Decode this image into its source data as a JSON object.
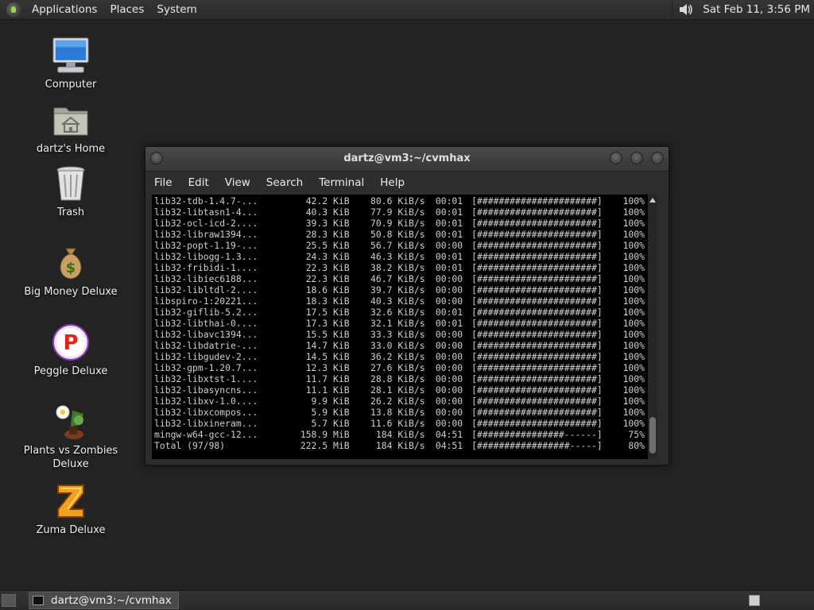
{
  "top_panel": {
    "applications": "Applications",
    "places": "Places",
    "system": "System",
    "clock": "Sat Feb 11,  3:56 PM"
  },
  "desktop_icons": [
    {
      "label": "Computer",
      "icon": "computer-icon"
    },
    {
      "label": "dartz's Home",
      "icon": "home-folder-icon"
    },
    {
      "label": "Trash",
      "icon": "trash-icon"
    },
    {
      "label": "Big Money Deluxe",
      "icon": "money-bag-icon"
    },
    {
      "label": "Peggle Deluxe",
      "icon": "peggle-icon"
    },
    {
      "label": "Plants vs Zombies Deluxe",
      "icon": "plants-vs-zombies-icon"
    },
    {
      "label": "Zuma Deluxe",
      "icon": "zuma-icon"
    }
  ],
  "terminal": {
    "title": "dartz@vm3:~/cvmhax",
    "menu": [
      "File",
      "Edit",
      "View",
      "Search",
      "Terminal",
      "Help"
    ],
    "lines": [
      {
        "name": "lib32-tdb-1.4.7-...",
        "size": "42.2 KiB",
        "rate": "80.6 KiB/s",
        "time": "00:01",
        "bar": "[######################]",
        "pct": "100%"
      },
      {
        "name": "lib32-libtasn1-4...",
        "size": "40.3 KiB",
        "rate": "77.9 KiB/s",
        "time": "00:01",
        "bar": "[######################]",
        "pct": "100%"
      },
      {
        "name": "lib32-ocl-icd-2....",
        "size": "39.3 KiB",
        "rate": "70.9 KiB/s",
        "time": "00:01",
        "bar": "[######################]",
        "pct": "100%"
      },
      {
        "name": "lib32-libraw1394...",
        "size": "28.3 KiB",
        "rate": "50.8 KiB/s",
        "time": "00:01",
        "bar": "[######################]",
        "pct": "100%"
      },
      {
        "name": "lib32-popt-1.19-...",
        "size": "25.5 KiB",
        "rate": "56.7 KiB/s",
        "time": "00:00",
        "bar": "[######################]",
        "pct": "100%"
      },
      {
        "name": "lib32-libogg-1.3...",
        "size": "24.3 KiB",
        "rate": "46.3 KiB/s",
        "time": "00:01",
        "bar": "[######################]",
        "pct": "100%"
      },
      {
        "name": "lib32-fribidi-1....",
        "size": "22.3 KiB",
        "rate": "38.2 KiB/s",
        "time": "00:01",
        "bar": "[######################]",
        "pct": "100%"
      },
      {
        "name": "lib32-libiec6188...",
        "size": "22.3 KiB",
        "rate": "46.7 KiB/s",
        "time": "00:00",
        "bar": "[######################]",
        "pct": "100%"
      },
      {
        "name": "lib32-libltdl-2....",
        "size": "18.6 KiB",
        "rate": "39.7 KiB/s",
        "time": "00:00",
        "bar": "[######################]",
        "pct": "100%"
      },
      {
        "name": "libspiro-1:20221...",
        "size": "18.3 KiB",
        "rate": "40.3 KiB/s",
        "time": "00:00",
        "bar": "[######################]",
        "pct": "100%"
      },
      {
        "name": "lib32-giflib-5.2...",
        "size": "17.5 KiB",
        "rate": "32.6 KiB/s",
        "time": "00:01",
        "bar": "[######################]",
        "pct": "100%"
      },
      {
        "name": "lib32-libthai-0....",
        "size": "17.3 KiB",
        "rate": "32.1 KiB/s",
        "time": "00:01",
        "bar": "[######################]",
        "pct": "100%"
      },
      {
        "name": "lib32-libavc1394...",
        "size": "15.5 KiB",
        "rate": "33.3 KiB/s",
        "time": "00:00",
        "bar": "[######################]",
        "pct": "100%"
      },
      {
        "name": "lib32-libdatrie-...",
        "size": "14.7 KiB",
        "rate": "33.0 KiB/s",
        "time": "00:00",
        "bar": "[######################]",
        "pct": "100%"
      },
      {
        "name": "lib32-libgudev-2...",
        "size": "14.5 KiB",
        "rate": "36.2 KiB/s",
        "time": "00:00",
        "bar": "[######################]",
        "pct": "100%"
      },
      {
        "name": "lib32-gpm-1.20.7...",
        "size": "12.3 KiB",
        "rate": "27.6 KiB/s",
        "time": "00:00",
        "bar": "[######################]",
        "pct": "100%"
      },
      {
        "name": "lib32-libxtst-1....",
        "size": "11.7 KiB",
        "rate": "28.8 KiB/s",
        "time": "00:00",
        "bar": "[######################]",
        "pct": "100%"
      },
      {
        "name": "lib32-libasyncns...",
        "size": "11.1 KiB",
        "rate": "28.1 KiB/s",
        "time": "00:00",
        "bar": "[######################]",
        "pct": "100%"
      },
      {
        "name": "lib32-libxv-1.0....",
        "size": "9.9 KiB",
        "rate": "26.2 KiB/s",
        "time": "00:00",
        "bar": "[######################]",
        "pct": "100%"
      },
      {
        "name": "lib32-libxcompos...",
        "size": "5.9 KiB",
        "rate": "13.8 KiB/s",
        "time": "00:00",
        "bar": "[######################]",
        "pct": "100%"
      },
      {
        "name": "lib32-libxineram...",
        "size": "5.7 KiB",
        "rate": "11.6 KiB/s",
        "time": "00:00",
        "bar": "[######################]",
        "pct": "100%"
      },
      {
        "name": "mingw-w64-gcc-12...",
        "size": "158.9 MiB",
        "rate": "184 KiB/s",
        "time": "04:51",
        "bar": "[################------]",
        "pct": "75%"
      },
      {
        "name": "Total (97/98)",
        "size": "222.5 MiB",
        "rate": "184 KiB/s",
        "time": "04:51",
        "bar": "[#################-----]",
        "pct": "80%"
      }
    ]
  },
  "taskbar": {
    "task_label": "dartz@vm3:~/cvmhax"
  },
  "colors": {
    "desktop_bg": "#222322",
    "terminal_bg": "#000000",
    "terminal_text": "#cfcfcf"
  }
}
